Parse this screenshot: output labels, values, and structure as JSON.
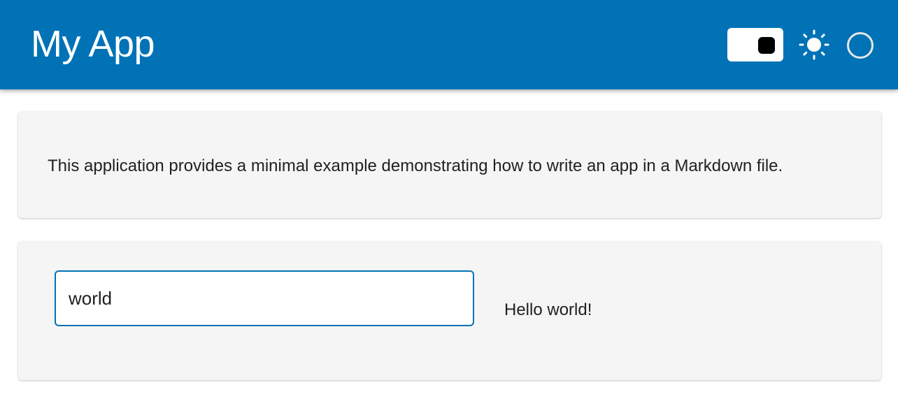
{
  "header": {
    "title": "My App",
    "accent_color": "#0072b5",
    "controls": [
      {
        "name": "theme-toggle",
        "state": "on"
      },
      {
        "name": "sun-icon"
      },
      {
        "name": "status-circle-icon"
      }
    ]
  },
  "main": {
    "description": "This application provides a minimal example demonstrating how to write an app in a Markdown file.",
    "input": {
      "value": "world",
      "placeholder": ""
    },
    "output": "Hello world!"
  }
}
